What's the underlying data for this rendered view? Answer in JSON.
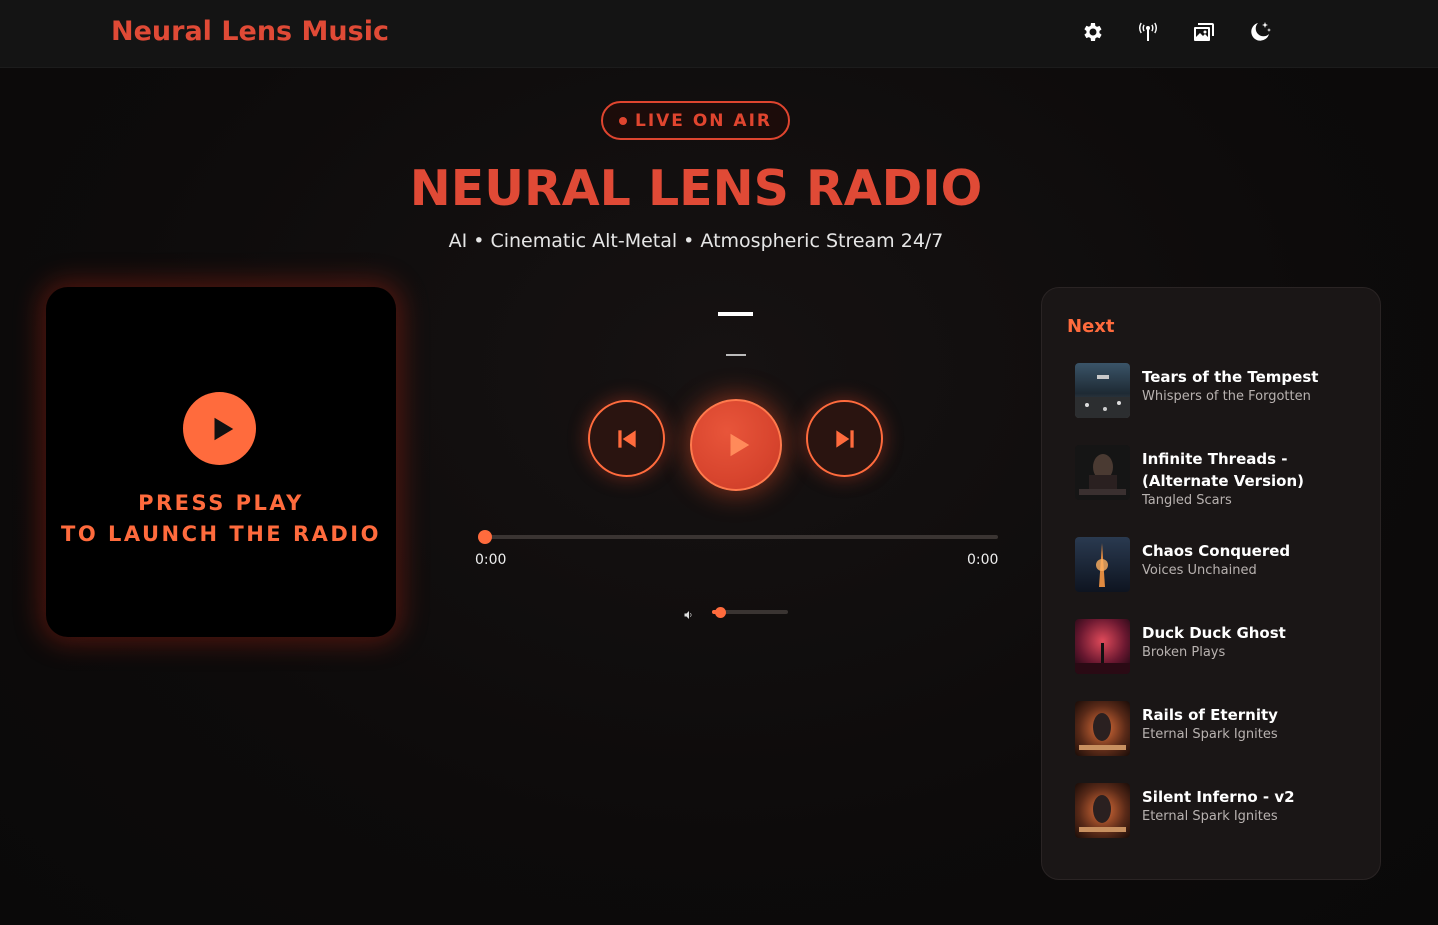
{
  "header": {
    "brand": "Neural Lens Music",
    "icons": [
      "gear-icon",
      "broadcast-icon",
      "image-icon",
      "moon-stars-icon"
    ]
  },
  "hero": {
    "live_label": "LIVE ON AIR",
    "title": "NEURAL LENS RADIO",
    "subtitle": "AI • Cinematic Alt-Metal • Atmospheric Stream 24/7"
  },
  "cover": {
    "line1": "PRESS PLAY",
    "line2": "TO LAUNCH THE RADIO"
  },
  "player": {
    "current_time": "0:00",
    "duration": "0:00",
    "progress": 0,
    "volume": 0.1
  },
  "queue": {
    "heading": "Next",
    "items": [
      {
        "title": "Tears of the Tempest",
        "artist": "Whispers of the Forgotten"
      },
      {
        "title": "Infinite Threads - (Alternate Version)",
        "artist": "Tangled Scars"
      },
      {
        "title": "Chaos Conquered",
        "artist": "Voices Unchained"
      },
      {
        "title": "Duck Duck Ghost",
        "artist": "Broken Plays"
      },
      {
        "title": "Rails of Eternity",
        "artist": "Eternal Spark Ignites"
      },
      {
        "title": "Silent Inferno - v2",
        "artist": "Eternal Spark Ignites"
      }
    ]
  },
  "colors": {
    "accent": "#ff6b3d",
    "brand_red": "#e04a36"
  }
}
